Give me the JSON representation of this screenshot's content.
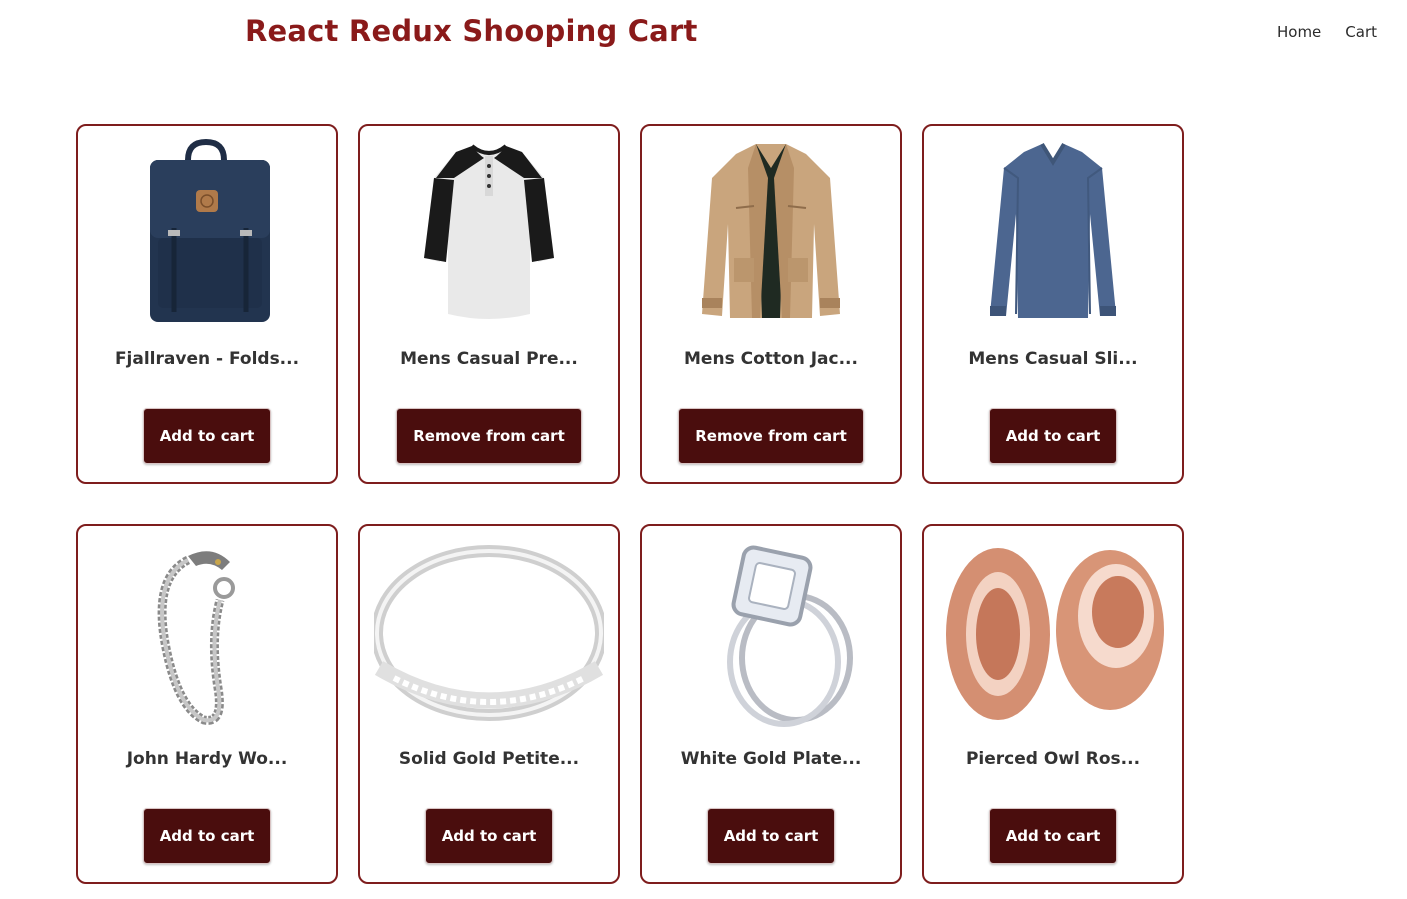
{
  "header": {
    "brand": "React Redux Shooping Cart",
    "nav": [
      "Home",
      "Cart"
    ]
  },
  "colors": {
    "brand": "#8a1a1a",
    "card_border": "#7e1d1d",
    "button_bg": "#4a0d0d",
    "button_text": "#ffffff"
  },
  "products": [
    {
      "title": "Fjallraven - Folds...",
      "button": "Add to cart",
      "image": "backpack-image"
    },
    {
      "title": "Mens Casual Pre...",
      "button": "Remove from cart",
      "image": "henley-shirt-image"
    },
    {
      "title": "Mens Cotton Jac...",
      "button": "Remove from cart",
      "image": "cotton-jacket-image"
    },
    {
      "title": "Mens Casual Sli...",
      "button": "Add to cart",
      "image": "long-sleeve-shirt-image"
    },
    {
      "title": "John Hardy Wo...",
      "button": "Add to cart",
      "image": "dragon-bracelet-image"
    },
    {
      "title": "Solid Gold Petite...",
      "button": "Add to cart",
      "image": "gold-ring-image"
    },
    {
      "title": "White Gold Plate...",
      "button": "Add to cart",
      "image": "diamond-ring-image"
    },
    {
      "title": "Pierced Owl Ros...",
      "button": "Add to cart",
      "image": "rose-gold-plugs-image"
    }
  ]
}
